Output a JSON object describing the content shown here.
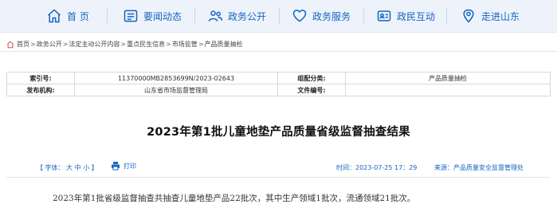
{
  "nav": {
    "items": [
      {
        "label": "首 页",
        "icon": "home-icon"
      },
      {
        "label": "要闻动态",
        "icon": "news-icon"
      },
      {
        "label": "政务公开",
        "icon": "people-icon"
      },
      {
        "label": "政务服务",
        "icon": "heart-icon"
      },
      {
        "label": "政民互动",
        "icon": "id-card-icon"
      },
      {
        "label": "走进山东",
        "icon": "location-pin-icon"
      }
    ],
    "color": "#1565c0"
  },
  "breadcrumb": [
    "首页",
    "政务公开",
    "法定主动公开内容",
    "重点民生信息",
    "市场监管",
    "产品质量抽检"
  ],
  "breadcrumb_sep": ">",
  "info": {
    "index_label": "索引号:",
    "index_value": "11370000MB2853699N/2023-02643",
    "category_label": "组配分类:",
    "category_value": "产品质量抽检",
    "publisher_label": "发布机构:",
    "publisher_value": "山东省市场监督管理局",
    "docno_label": "文件编号:",
    "docno_value": ""
  },
  "title": "2023年第1批儿童地垫产品质量省级监督抽查结果",
  "toolbar": {
    "font_prefix": "【 字体：",
    "font_large": "大",
    "font_medium": "中",
    "font_small": "小",
    "font_suffix": " 】",
    "print": "打印",
    "time": "时间：2023-07-25 17：29",
    "source": "来源：产品质量安全监督管理处"
  },
  "body": {
    "paragraph": "2023年第1批省级监督抽查共抽查儿童地垫产品22批次，其中生产领域1批次，流通领域21批次。"
  }
}
